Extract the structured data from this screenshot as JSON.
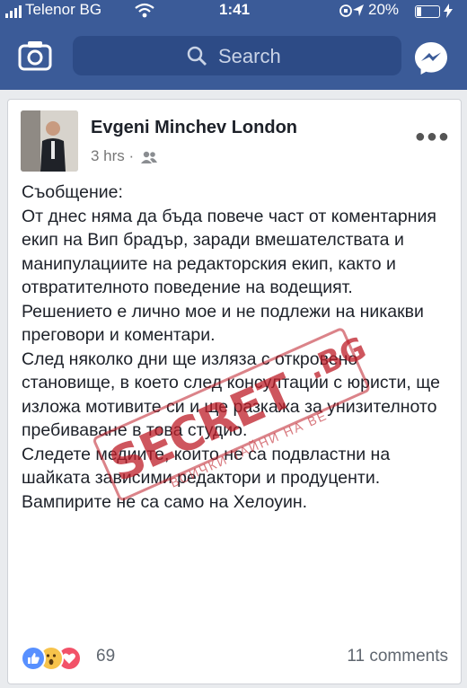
{
  "status_bar": {
    "carrier": "Telenor BG",
    "time": "1:41",
    "battery": "20%"
  },
  "top_bar": {
    "search_placeholder": "Search"
  },
  "post": {
    "author": "Evgeni Minchev London",
    "time": "3 hrs",
    "separator": "·",
    "audience_icon": "friends-icon",
    "message": "Съобщение:\nОт днес няма да бъда повече част от коментарния екип на Вип брадър, заради вмешателствата и манипулациите на редакторския екип, както и отвратителното поведение на водещият.\nРешението е лично мое и не подлежи на никакви преговори и коментари.\nСлед няколко дни ще изляза с откровено становище, в което след консултации с юристи, ще изложа мотивите си и ще разкажа за унизителното пребиваване в това студио.\nСледете медиите, които не са подвластни на шайката зависими редактори и продуценти.\nВампирите не са само на Хелоуин.",
    "watermark": {
      "word": "SECRET",
      "suffix": ".BG",
      "subtitle": "ВСИЧКИ ТАЙНИ НА ВЕ"
    },
    "reactions": {
      "icons": [
        "like-icon",
        "wow-icon",
        "love-icon"
      ],
      "count": "69"
    },
    "comments": "11 comments"
  },
  "colors": {
    "header": "#3b5b98",
    "search": "#2d4b86",
    "like": "#5890ff",
    "wow": "#f7c34b",
    "love": "#f25268",
    "stamp": "#be1e28"
  }
}
